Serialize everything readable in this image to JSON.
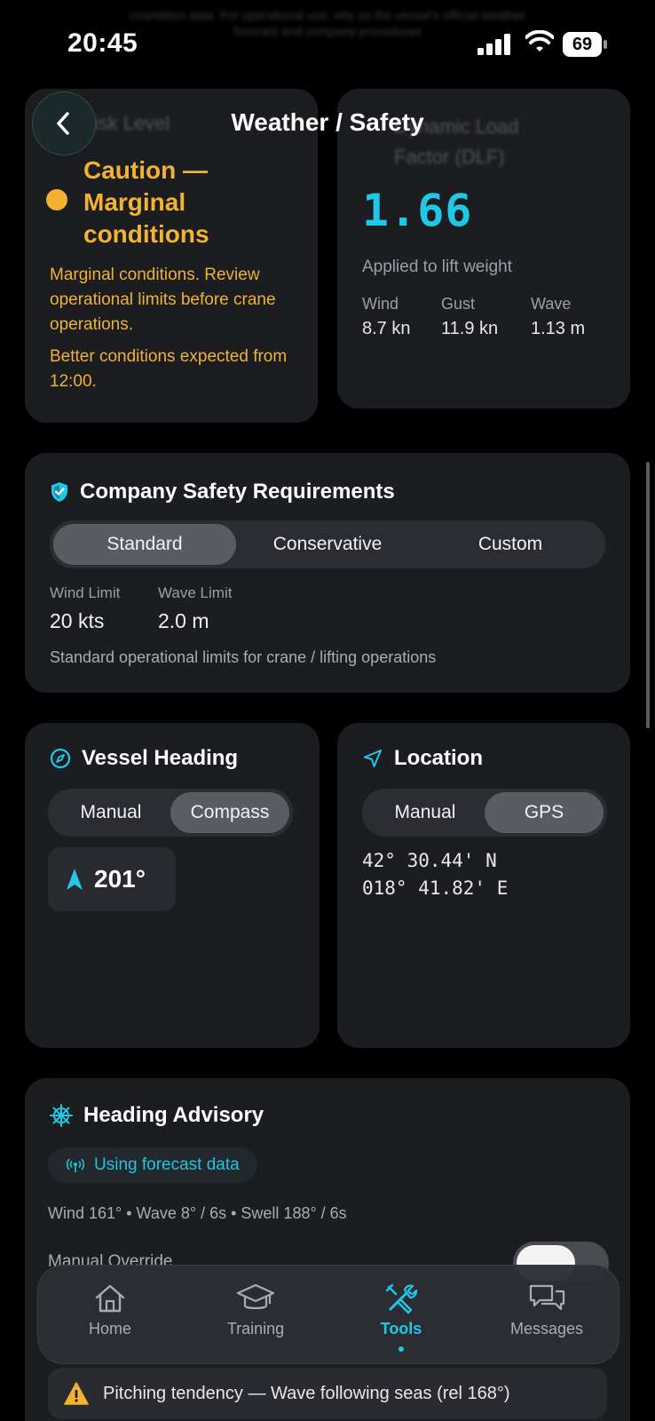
{
  "status_bar": {
    "time": "20:45",
    "battery": "69"
  },
  "faded_text": {
    "top_line_1": "ccondition data. For operational use, rely on the vessel's official weather",
    "top_line_2": "forecast and company procedures",
    "risk_level_label": "Risk Level",
    "dlf_label_1": "Dynamic Load",
    "dlf_label_2": "Factor (DLF)"
  },
  "header": {
    "title": "Weather / Safety"
  },
  "risk": {
    "status": "Caution — Marginal conditions",
    "description": "Marginal conditions. Review operational limits before crane operations.",
    "outlook": "Better conditions expected from 12:00.",
    "color": "#f3b22f"
  },
  "dlf": {
    "value": "1.66",
    "caption": "Applied to lift weight",
    "stats": [
      {
        "label": "Wind",
        "value": "8.7 kn"
      },
      {
        "label": "Gust",
        "value": "11.9 kn"
      },
      {
        "label": "Wave",
        "value": "1.13 m"
      }
    ],
    "color": "#1ec8e6"
  },
  "safety": {
    "title": "Company Safety Requirements",
    "icon": "shield-icon",
    "options": [
      "Standard",
      "Conservative",
      "Custom"
    ],
    "selected": "Standard",
    "wind_limit_label": "Wind Limit",
    "wind_limit_value": "20 kts",
    "wave_limit_label": "Wave Limit",
    "wave_limit_value": "2.0 m",
    "note": "Standard operational limits for crane / lifting operations"
  },
  "vessel_heading": {
    "title": "Vessel Heading",
    "icon": "compass-icon",
    "options": [
      "Manual",
      "Compass"
    ],
    "selected": "Compass",
    "value": "201°"
  },
  "location": {
    "title": "Location",
    "icon": "navigation-icon",
    "options": [
      "Manual",
      "GPS"
    ],
    "selected": "GPS",
    "latitude": "42° 30.44' N",
    "longitude": "018° 41.82' E"
  },
  "advisory": {
    "title": "Heading Advisory",
    "icon": "helm-icon",
    "source": "Using forecast data",
    "conditions": "Wind 161° • Wave 8° / 6s • Swell 188° / 6s",
    "override_label": "Manual Override",
    "override_on": false,
    "warning": "Pitching tendency — Wave following seas (rel 168°)"
  },
  "tabs": [
    {
      "label": "Home",
      "icon": "home-icon"
    },
    {
      "label": "Training",
      "icon": "graduation-cap-icon"
    },
    {
      "label": "Tools",
      "icon": "tools-icon",
      "active": true
    },
    {
      "label": "Messages",
      "icon": "messages-icon"
    }
  ]
}
